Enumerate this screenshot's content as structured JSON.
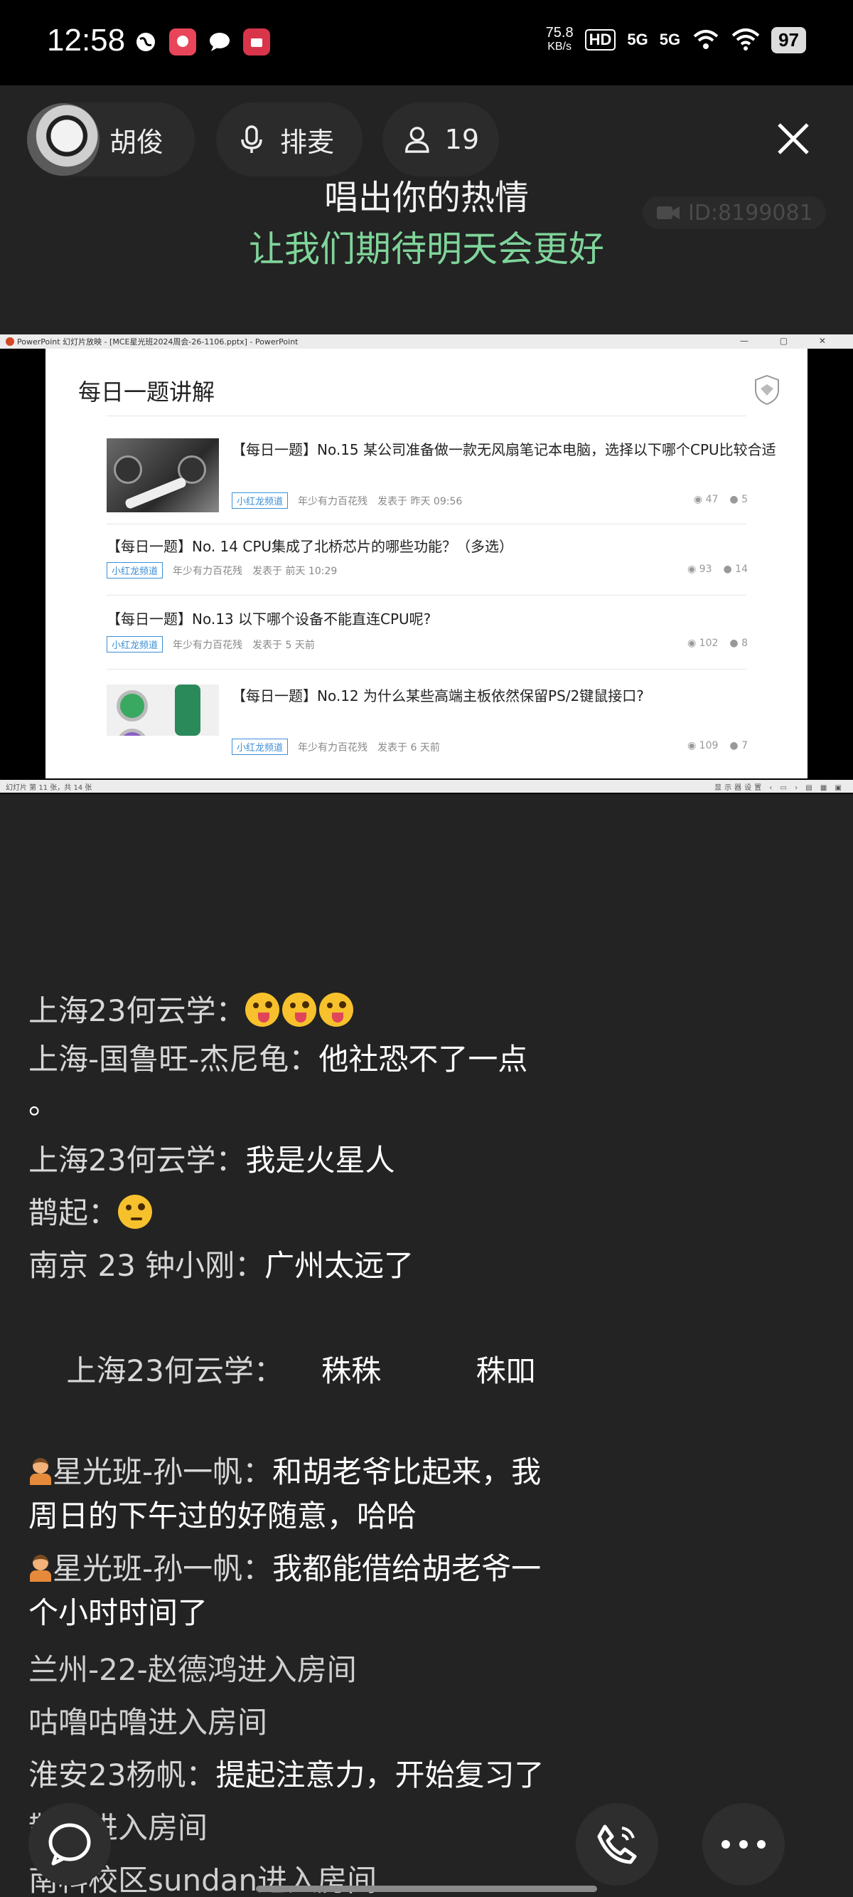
{
  "status_bar": {
    "time": "12:58",
    "net_speed": "75.8",
    "net_unit": "KB/s",
    "hd_tag": "HD",
    "sim1": "5G",
    "sim2": "5G",
    "battery": "97"
  },
  "header": {
    "host_name": "胡俊",
    "queue_label": "排麦",
    "audience_count": "19",
    "room_id": "ID:8199081",
    "lyric_line1": "唱出你的热情",
    "lyric_line2": "让我们期待明天会更好"
  },
  "screen_share": {
    "window_title": "PowerPoint 幻灯片放映 - [MCE星光班2024周会-26-1106.pptx] - PowerPoint",
    "slide_heading": "每日一题讲解",
    "posts": [
      {
        "title": "【每日一题】No.15 某公司准备做一款无风扇笔记本电脑，选择以下哪个CPU比较合适",
        "badge": "小红龙频道",
        "author": "年少有力百花残",
        "time": "发表于 昨天 09:56",
        "views": "47",
        "comments": "5"
      },
      {
        "title": "【每日一题】No. 14 CPU集成了北桥芯片的哪些功能？（多选）",
        "badge": "小红龙频道",
        "author": "年少有力百花残",
        "time": "发表于 前天 10:29",
        "views": "93",
        "comments": "14"
      },
      {
        "title": "【每日一题】No.13 以下哪个设备不能直连CPU呢?",
        "badge": "小红龙频道",
        "author": "年少有力百花残",
        "time": "发表于 5 天前",
        "views": "102",
        "comments": "8"
      },
      {
        "title": "【每日一题】No.12 为什么某些高端主板依然保留PS/2键鼠接口?",
        "badge": "小红龙频道",
        "author": "年少有力百花残",
        "time": "发表于 6 天前",
        "views": "109",
        "comments": "7"
      }
    ],
    "status_left": "幻灯片 第 11 张，共 14 张",
    "status_right": "显示器设置"
  },
  "chat": [
    {
      "name": "上海23何云学：",
      "text": "",
      "emojis": 3
    },
    {
      "name": "上海-国鲁旺-杰尼龟：",
      "text": "他社恐不了一点",
      "cont": "。"
    },
    {
      "name": "上海23何云学：",
      "text": "我是火星人"
    },
    {
      "name": "鹊起：",
      "text": ""
    },
    {
      "name": "南京 23 钟小刚：",
      "text": "广州太远了"
    },
    {
      "name": "上海23何云学：",
      "text": "    秼秼          秼吅"
    },
    {
      "name": "星光班-孙一帆：",
      "text": "和胡老爷比起来，我",
      "cont": "周日的下午过的好随意，哈哈"
    },
    {
      "name": "星光班-孙一帆：",
      "text": "我都能借给胡老爷一",
      "cont": "个小时时间了"
    },
    {
      "enter": "兰州-22-赵德鸿进入房间"
    },
    {
      "enter": "咕噜咕噜进入房间"
    },
    {
      "name": "淮安23杨帆：",
      "text": "提起注意力，开始复习了"
    },
    {
      "enter": "鹊起进入房间"
    },
    {
      "enter": "南科校区sundan进入房间"
    }
  ],
  "colors": {
    "background": "#232323",
    "lyric_highlight": "#7fd49a",
    "badge_blue": "#3b8fd8"
  },
  "icons": {
    "mic": "mic-icon",
    "person": "person-icon",
    "close": "close-icon",
    "chat": "chat-bubble-icon",
    "phone": "phone-icon",
    "more": "more-icon"
  }
}
